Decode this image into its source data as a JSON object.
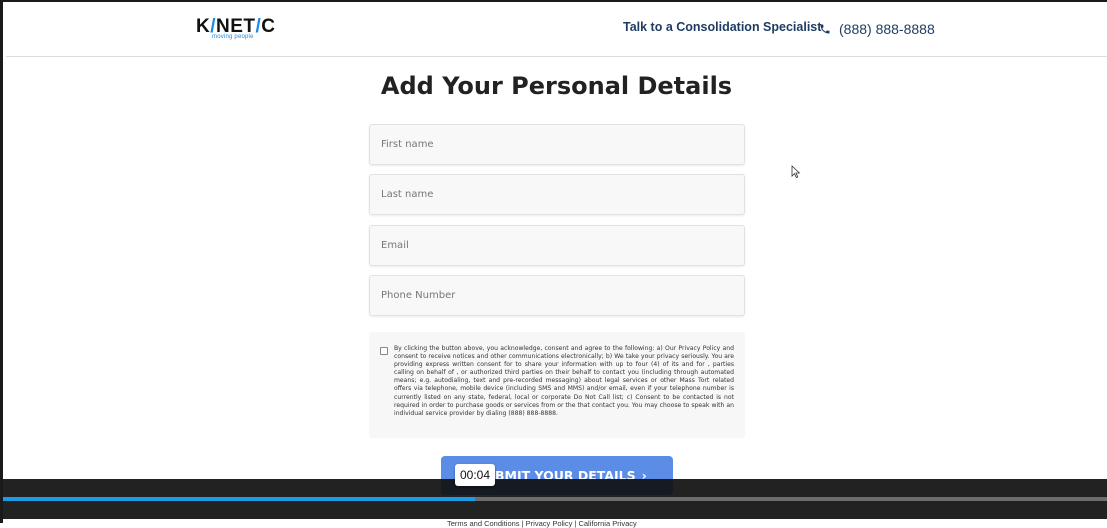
{
  "header": {
    "logo_text_left": "K",
    "logo_slash": "/",
    "logo_text_mid": "NET",
    "logo_slash2": "/",
    "logo_text_right": "C",
    "logo_tagline": "moving people",
    "cta_text": "Talk to a Consolidation Specialist",
    "phone_icon": "phone-icon",
    "phone_number": "(888) 888-8888"
  },
  "form": {
    "title": "Add Your Personal Details",
    "first_name_placeholder": "First name",
    "last_name_placeholder": "Last name",
    "email_placeholder": "Email",
    "phone_placeholder": "Phone Number",
    "consent_checked": false,
    "consent_text": "By clicking the button above, you acknowledge, consent and agree to the following: a) Our Privacy Policy and consent to receive notices and other communications electronically; b) We take your privacy seriously. You are providing express written consent for to share your information with up to four (4) of its and for , parties calling on behalf of , or authorized third parties on their behalf to contact you (including through automated means; e.g. autodialing, text and pre-recorded messaging) about legal services or other Mass Tort related offers via telephone, mobile device (including SMS and MMS) and/or email, even if your telephone number is currently listed on any state, federal, local or corporate Do Not Call list; c) Consent to be contacted is not required in order to purchase goods or services from or the that contact you. You may choose to speak with an individual service provider by dialing (888) 888-8888.",
    "submit_label": "BMIT YOUR DETAILS",
    "submit_chevron": "›"
  },
  "footer": {
    "links_text": "Terms and Conditions  |  Privacy Policy  |  California Privacy"
  },
  "video_player": {
    "timestamp": "00:04",
    "progress_fraction": 0.426,
    "progress_color": "#1c9be8"
  },
  "colors": {
    "brand_blue": "#1e88e5",
    "header_text": "#1f3d63",
    "button_bg": "#5b8de6"
  }
}
